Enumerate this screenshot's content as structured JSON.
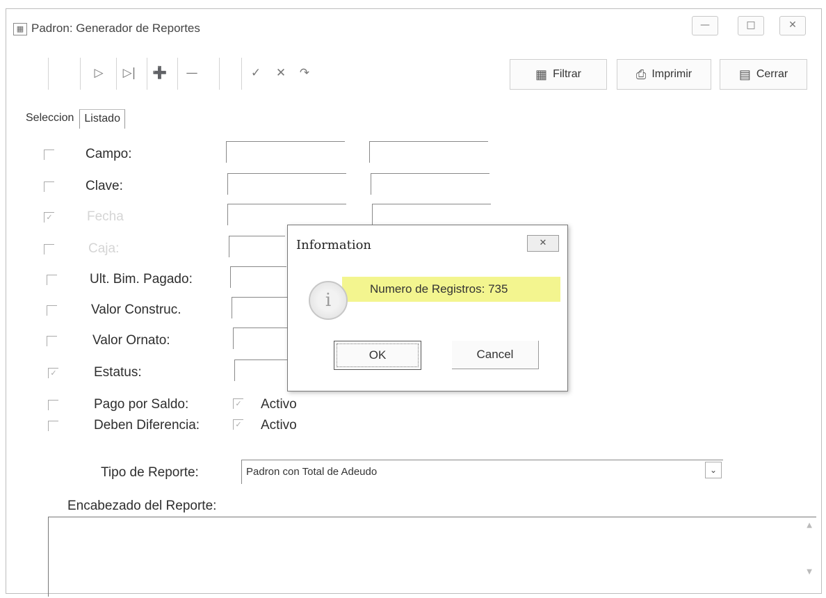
{
  "window": {
    "title": "Padron: Generador de Reportes"
  },
  "toolbar": {
    "nav_icons": [
      "play-icon",
      "skip-end-icon",
      "plus-icon",
      "minus-icon",
      "check-icon",
      "x-icon",
      "redo-icon"
    ],
    "filtrar_label": "Filtrar",
    "imprimir_label": "Imprimir",
    "cerrar_label": "Cerrar"
  },
  "tabs": [
    "Seleccion",
    "Listado"
  ],
  "form": {
    "rows": [
      {
        "label": "Campo:"
      },
      {
        "label": "Clave:"
      },
      {
        "label": "Fecha"
      },
      {
        "label": "Caja:"
      },
      {
        "label": "Ult. Bim. Pagado:"
      },
      {
        "label": "Valor Construc."
      },
      {
        "label": "Valor Ornato:"
      },
      {
        "label": "Estatus:"
      },
      {
        "label": "Pago por Saldo:",
        "inline": "Activo"
      },
      {
        "label": "Deben Diferencia:",
        "inline": "Activo"
      }
    ],
    "tipo_label": "Tipo de Reporte:",
    "tipo_value": "Padron con Total de Adeudo",
    "encabezado_label": "Encabezado del Reporte:"
  },
  "dialog": {
    "title": "Information",
    "message": "Numero de Registros: 735",
    "ok_label": "OK",
    "cancel_label": "Cancel",
    "highlight_color": "#f3f58f"
  }
}
